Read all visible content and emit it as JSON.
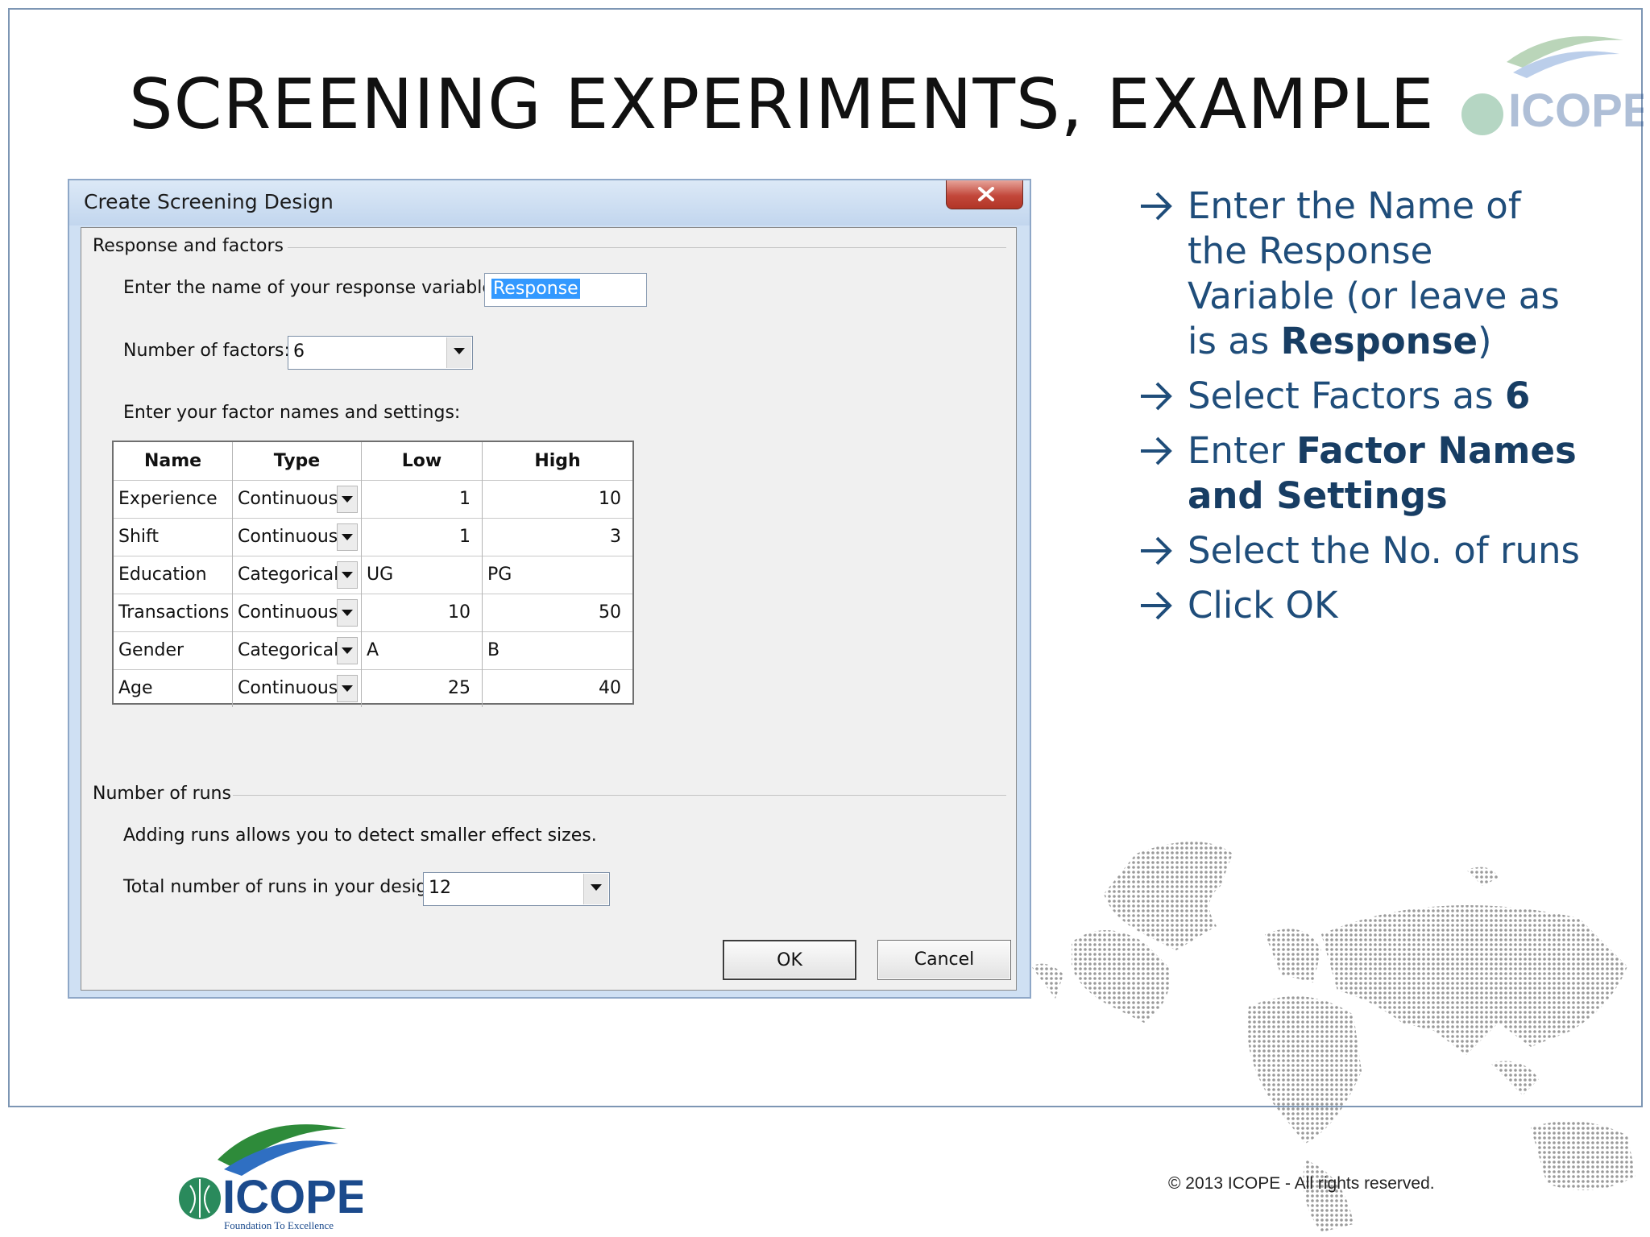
{
  "slide": {
    "title": "SCREENING EXPERIMENTS, EXAMPLE",
    "copyright": "©  2013 ICOPE - All rights reserved.",
    "logo_text": "ICOPE",
    "logo_tagline": "Foundation To Excellence"
  },
  "dialog": {
    "title": "Create Screening Design",
    "close_icon": "close-icon",
    "response_group_label": "Response and factors",
    "response_label": "Enter the name of your response variable:",
    "response_value": "Response",
    "factors_label": "Number of factors:",
    "factors_value": "6",
    "factor_settings_label": "Enter your factor names and settings:",
    "grid_headers": [
      "Name",
      "Type",
      "Low",
      "High"
    ],
    "factors": [
      {
        "name": "Experience",
        "type": "Continuous",
        "low": "1",
        "high": "10"
      },
      {
        "name": "Shift",
        "type": "Continuous",
        "low": "1",
        "high": "3"
      },
      {
        "name": "Education",
        "type": "Categorical",
        "low": "UG",
        "high": "PG"
      },
      {
        "name": "Transactions",
        "type": "Continuous",
        "low": "10",
        "high": "50"
      },
      {
        "name": "Gender",
        "type": "Categorical",
        "low": "A",
        "high": "B"
      },
      {
        "name": "Age",
        "type": "Continuous",
        "low": "25",
        "high": "40"
      }
    ],
    "runs_group_label": "Number of runs",
    "runs_note": "Adding runs allows you to detect smaller effect sizes.",
    "runs_label": "Total number of runs in your design:",
    "runs_value": "12",
    "ok_label": "OK",
    "cancel_label": "Cancel"
  },
  "instructions": {
    "arrow_icon": "right-arrow-icon",
    "item1_a": "Enter the Name of the Response Variable (or leave as is as ",
    "item1_b": "Response",
    "item1_c": ")",
    "item2_a": "Select Factors as ",
    "item2_b": "6",
    "item3_a": "Enter ",
    "item3_b": "Factor Names and Settings",
    "item4": "Select the No. of runs",
    "item5": "Click OK"
  },
  "colors": {
    "instruction_text": "#1f4d7a",
    "selection": "#3399ff",
    "dialog_frame": "#cfe0f3"
  }
}
